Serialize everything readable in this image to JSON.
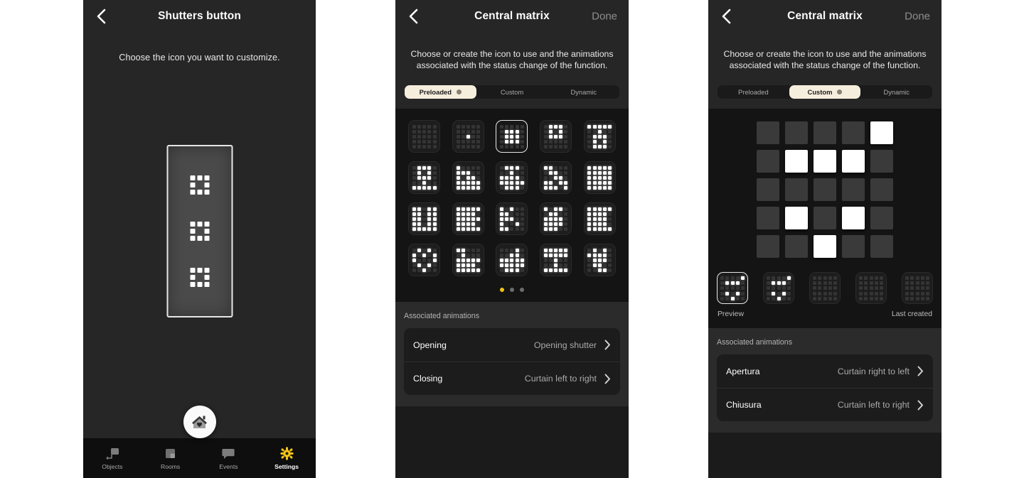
{
  "panel1": {
    "nav": {
      "title": "Shutters button",
      "back_icon": "chevron-left-icon"
    },
    "subtitle": "Choose the icon you want to customize.",
    "device": {
      "matrix_label": "matrix-icon",
      "pattern": [
        [
          1,
          1,
          1
        ],
        [
          1,
          0,
          1
        ],
        [
          1,
          1,
          1
        ]
      ]
    },
    "fab": {
      "icon": "home-heart-icon"
    },
    "tabs": [
      {
        "label": "Objects",
        "icon": "objects-icon",
        "active": false
      },
      {
        "label": "Rooms",
        "icon": "rooms-icon",
        "active": false
      },
      {
        "label": "Events",
        "icon": "events-icon",
        "active": false
      },
      {
        "label": "Settings",
        "icon": "settings-gear-icon",
        "active": true
      }
    ]
  },
  "panel2": {
    "nav": {
      "title": "Central matrix",
      "done_label": "Done",
      "back_icon": "chevron-left-icon"
    },
    "intro": "Choose or create the icon to use and the animations associated with the status change of the function.",
    "segments": [
      {
        "label": "Preloaded",
        "active": true
      },
      {
        "label": "Custom",
        "active": false
      },
      {
        "label": "Dynamic",
        "active": false
      }
    ],
    "icons": [
      {
        "selected": false,
        "pattern": [
          [
            0,
            0,
            0,
            0,
            0
          ],
          [
            0,
            0,
            0,
            0,
            0
          ],
          [
            0,
            0,
            0,
            0,
            0
          ],
          [
            0,
            0,
            0,
            0,
            0
          ],
          [
            0,
            0,
            0,
            0,
            0
          ]
        ]
      },
      {
        "selected": false,
        "pattern": [
          [
            0,
            0,
            0,
            0,
            0
          ],
          [
            0,
            0,
            0,
            0,
            0
          ],
          [
            0,
            0,
            1,
            0,
            0
          ],
          [
            0,
            0,
            0,
            0,
            0
          ],
          [
            0,
            0,
            0,
            0,
            0
          ]
        ]
      },
      {
        "selected": true,
        "pattern": [
          [
            0,
            0,
            0,
            0,
            0
          ],
          [
            0,
            1,
            1,
            1,
            0
          ],
          [
            0,
            1,
            1,
            1,
            0
          ],
          [
            0,
            1,
            1,
            1,
            0
          ],
          [
            0,
            0,
            0,
            0,
            0
          ]
        ]
      },
      {
        "selected": false,
        "pattern": [
          [
            0,
            1,
            1,
            1,
            0
          ],
          [
            0,
            1,
            0,
            1,
            0
          ],
          [
            0,
            1,
            1,
            1,
            0
          ],
          [
            0,
            0,
            0,
            0,
            0
          ],
          [
            0,
            0,
            0,
            0,
            0
          ]
        ]
      },
      {
        "selected": false,
        "pattern": [
          [
            1,
            1,
            1,
            1,
            1
          ],
          [
            0,
            0,
            1,
            0,
            0
          ],
          [
            0,
            1,
            1,
            1,
            0
          ],
          [
            0,
            1,
            0,
            1,
            0
          ],
          [
            0,
            1,
            1,
            1,
            0
          ]
        ]
      },
      {
        "selected": false,
        "pattern": [
          [
            0,
            1,
            1,
            1,
            0
          ],
          [
            0,
            1,
            0,
            1,
            0
          ],
          [
            0,
            1,
            1,
            1,
            0
          ],
          [
            0,
            0,
            1,
            0,
            0
          ],
          [
            1,
            1,
            1,
            1,
            1
          ]
        ]
      },
      {
        "selected": false,
        "pattern": [
          [
            1,
            0,
            0,
            0,
            0
          ],
          [
            1,
            1,
            1,
            0,
            0
          ],
          [
            1,
            0,
            1,
            1,
            0
          ],
          [
            1,
            1,
            1,
            1,
            1
          ],
          [
            1,
            1,
            1,
            1,
            1
          ]
        ]
      },
      {
        "selected": false,
        "pattern": [
          [
            0,
            1,
            1,
            1,
            0
          ],
          [
            0,
            0,
            1,
            0,
            0
          ],
          [
            1,
            1,
            1,
            1,
            0
          ],
          [
            1,
            1,
            1,
            1,
            1
          ],
          [
            0,
            1,
            1,
            1,
            0
          ]
        ]
      },
      {
        "selected": false,
        "pattern": [
          [
            1,
            1,
            0,
            0,
            0
          ],
          [
            0,
            1,
            1,
            0,
            0
          ],
          [
            0,
            0,
            1,
            1,
            0
          ],
          [
            1,
            1,
            0,
            1,
            1
          ],
          [
            1,
            1,
            1,
            0,
            1
          ]
        ]
      },
      {
        "selected": false,
        "pattern": [
          [
            1,
            1,
            1,
            1,
            1
          ],
          [
            1,
            1,
            1,
            1,
            1
          ],
          [
            1,
            1,
            1,
            1,
            1
          ],
          [
            1,
            1,
            1,
            1,
            1
          ],
          [
            1,
            1,
            1,
            1,
            1
          ]
        ]
      },
      {
        "selected": false,
        "pattern": [
          [
            1,
            1,
            0,
            1,
            1
          ],
          [
            1,
            1,
            0,
            1,
            1
          ],
          [
            1,
            1,
            0,
            1,
            1
          ],
          [
            1,
            1,
            0,
            1,
            1
          ],
          [
            1,
            1,
            1,
            1,
            1
          ]
        ]
      },
      {
        "selected": false,
        "pattern": [
          [
            1,
            1,
            1,
            1,
            1
          ],
          [
            1,
            1,
            1,
            1,
            0
          ],
          [
            1,
            1,
            1,
            1,
            1
          ],
          [
            1,
            1,
            1,
            1,
            0
          ],
          [
            1,
            1,
            1,
            1,
            1
          ]
        ]
      },
      {
        "selected": false,
        "pattern": [
          [
            1,
            0,
            1,
            0,
            0
          ],
          [
            1,
            1,
            0,
            0,
            0
          ],
          [
            1,
            1,
            1,
            0,
            0
          ],
          [
            1,
            0,
            0,
            1,
            0
          ],
          [
            1,
            1,
            0,
            0,
            0
          ]
        ]
      },
      {
        "selected": false,
        "pattern": [
          [
            1,
            0,
            1,
            1,
            0
          ],
          [
            0,
            1,
            1,
            0,
            0
          ],
          [
            1,
            1,
            1,
            1,
            0
          ],
          [
            1,
            1,
            1,
            1,
            0
          ],
          [
            1,
            1,
            1,
            0,
            0
          ]
        ]
      },
      {
        "selected": false,
        "pattern": [
          [
            1,
            1,
            1,
            1,
            1
          ],
          [
            1,
            1,
            1,
            1,
            0
          ],
          [
            1,
            1,
            1,
            1,
            0
          ],
          [
            1,
            1,
            1,
            1,
            0
          ],
          [
            1,
            1,
            1,
            1,
            1
          ]
        ]
      },
      {
        "selected": false,
        "pattern": [
          [
            0,
            1,
            0,
            1,
            0
          ],
          [
            1,
            0,
            1,
            0,
            1
          ],
          [
            1,
            0,
            0,
            0,
            1
          ],
          [
            0,
            1,
            0,
            1,
            0
          ],
          [
            0,
            0,
            1,
            0,
            0
          ]
        ]
      },
      {
        "selected": false,
        "pattern": [
          [
            1,
            1,
            0,
            0,
            0
          ],
          [
            0,
            1,
            0,
            0,
            0
          ],
          [
            1,
            1,
            1,
            1,
            1
          ],
          [
            1,
            1,
            1,
            1,
            0
          ],
          [
            1,
            1,
            1,
            1,
            1
          ]
        ]
      },
      {
        "selected": false,
        "pattern": [
          [
            0,
            0,
            0,
            1,
            0
          ],
          [
            0,
            0,
            1,
            1,
            0
          ],
          [
            1,
            1,
            1,
            1,
            1
          ],
          [
            1,
            1,
            1,
            1,
            1
          ],
          [
            0,
            1,
            1,
            1,
            0
          ]
        ]
      },
      {
        "selected": false,
        "pattern": [
          [
            1,
            1,
            1,
            1,
            1
          ],
          [
            1,
            1,
            1,
            1,
            1
          ],
          [
            0,
            0,
            1,
            0,
            0
          ],
          [
            0,
            0,
            1,
            0,
            0
          ],
          [
            1,
            1,
            1,
            1,
            1
          ]
        ]
      },
      {
        "selected": false,
        "pattern": [
          [
            0,
            1,
            0,
            1,
            0
          ],
          [
            1,
            1,
            1,
            1,
            0
          ],
          [
            0,
            1,
            1,
            1,
            0
          ],
          [
            0,
            1,
            1,
            0,
            0
          ],
          [
            0,
            0,
            1,
            1,
            0
          ]
        ]
      }
    ],
    "page_dots": [
      true,
      false,
      false
    ],
    "animations_title": "Associated animations",
    "animations": [
      {
        "label": "Opening",
        "value": "Opening shutter",
        "chevron": "chevron-right-icon"
      },
      {
        "label": "Closing",
        "value": "Curtain left to right",
        "chevron": "chevron-right-icon"
      }
    ]
  },
  "panel3": {
    "nav": {
      "title": "Central matrix",
      "done_label": "Done",
      "back_icon": "chevron-left-icon"
    },
    "intro": "Choose or create the icon to use and the animations associated with the status change of the function.",
    "segments": [
      {
        "label": "Preloaded",
        "active": false
      },
      {
        "label": "Custom",
        "active": true
      },
      {
        "label": "Dynamic",
        "active": false
      }
    ],
    "editor_pattern": [
      [
        0,
        0,
        0,
        0,
        1
      ],
      [
        0,
        1,
        1,
        1,
        0
      ],
      [
        0,
        0,
        0,
        0,
        0
      ],
      [
        0,
        1,
        0,
        1,
        0
      ],
      [
        0,
        0,
        1,
        0,
        0
      ]
    ],
    "thumbnails": [
      {
        "selected": true,
        "pattern": [
          [
            0,
            0,
            0,
            0,
            1
          ],
          [
            0,
            1,
            1,
            1,
            0
          ],
          [
            0,
            0,
            0,
            0,
            0
          ],
          [
            0,
            1,
            0,
            1,
            0
          ],
          [
            0,
            0,
            1,
            0,
            0
          ]
        ]
      },
      {
        "selected": false,
        "pattern": [
          [
            0,
            0,
            0,
            0,
            1
          ],
          [
            0,
            1,
            1,
            1,
            0
          ],
          [
            0,
            0,
            0,
            0,
            0
          ],
          [
            0,
            1,
            0,
            1,
            0
          ],
          [
            0,
            0,
            1,
            0,
            0
          ]
        ]
      },
      {
        "selected": false,
        "pattern": [
          [
            0,
            0,
            0,
            0,
            0
          ],
          [
            0,
            0,
            0,
            0,
            0
          ],
          [
            0,
            0,
            0,
            0,
            0
          ],
          [
            0,
            0,
            0,
            0,
            0
          ],
          [
            0,
            0,
            0,
            0,
            0
          ]
        ]
      },
      {
        "selected": false,
        "pattern": [
          [
            0,
            0,
            0,
            0,
            0
          ],
          [
            0,
            0,
            0,
            0,
            0
          ],
          [
            0,
            0,
            0,
            0,
            0
          ],
          [
            0,
            0,
            0,
            0,
            0
          ],
          [
            0,
            0,
            0,
            0,
            0
          ]
        ]
      },
      {
        "selected": false,
        "pattern": [
          [
            0,
            0,
            0,
            0,
            0
          ],
          [
            0,
            0,
            0,
            0,
            0
          ],
          [
            0,
            0,
            0,
            0,
            0
          ],
          [
            0,
            0,
            0,
            0,
            0
          ],
          [
            0,
            0,
            0,
            0,
            0
          ]
        ]
      }
    ],
    "preview_label": "Preview",
    "last_created_label": "Last created",
    "animations_title": "Associated animations",
    "animations": [
      {
        "label": "Apertura",
        "value": "Curtain right to left",
        "chevron": "chevron-right-icon"
      },
      {
        "label": "Chiusura",
        "value": "Curtain left to right",
        "chevron": "chevron-right-icon"
      }
    ]
  },
  "colors": {
    "accent_yellow": "#f3c21a",
    "segment_active_bg": "#f6eedd",
    "panel_bg": "#262626",
    "grid_bg": "#141414",
    "led_on": "#ffffff",
    "led_off": "#343434"
  }
}
